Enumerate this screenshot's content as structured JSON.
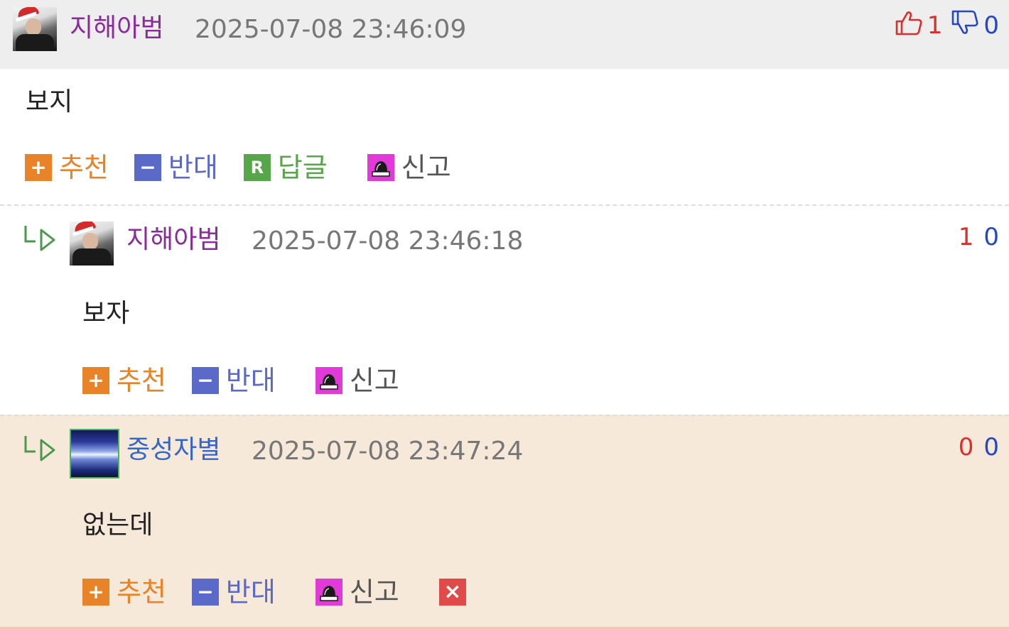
{
  "comments": [
    {
      "nickname": "지해아범",
      "timestamp": "2025-07-08 23:46:09",
      "up_count": "1",
      "down_count": "0",
      "text": "보지",
      "actions": {
        "recommend": "추천",
        "oppose": "반대",
        "reply": "답글",
        "reply_icon": "R",
        "report": "신고"
      }
    },
    {
      "nickname": "지해아범",
      "timestamp": "2025-07-08 23:46:18",
      "up_count": "1",
      "down_count": "0",
      "text": "보자",
      "actions": {
        "recommend": "추천",
        "oppose": "반대",
        "report": "신고"
      }
    },
    {
      "nickname": "중성자별",
      "timestamp": "2025-07-08 23:47:24",
      "up_count": "0",
      "down_count": "0",
      "text": "없는데",
      "actions": {
        "recommend": "추천",
        "oppose": "반대",
        "report": "신고"
      }
    }
  ],
  "icons": {
    "recommend": "+",
    "oppose": "−",
    "delete": "×",
    "thumb_up": "thumbs-up-icon",
    "thumb_down": "thumbs-down-icon",
    "reply_arrow": "reply-arrow-icon",
    "report": "siren-icon"
  },
  "colors": {
    "recommend": "#e8832a",
    "oppose": "#5b6ac9",
    "reply": "#58a64a",
    "report": "#e23ad8",
    "delete": "#e04a48",
    "up_count": "#d9302c",
    "down_count": "#2347c8",
    "highlight_bg": "#f7e9da"
  }
}
